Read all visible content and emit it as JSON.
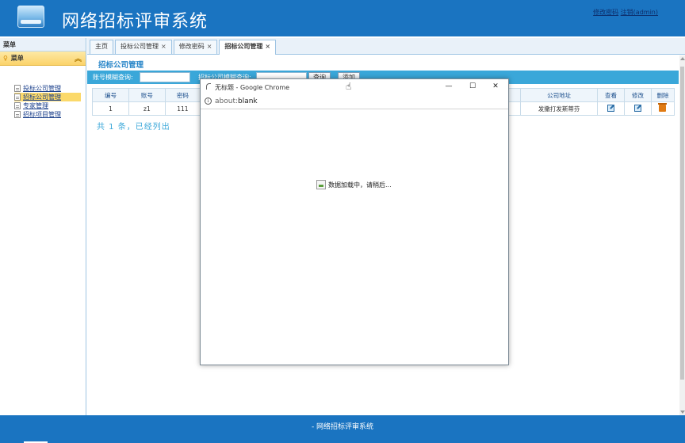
{
  "header": {
    "title": "网络招标评审系统",
    "links": [
      "修改密码",
      "注销(admin)"
    ]
  },
  "sidebar": {
    "header": "菜单",
    "panel_title": "菜单",
    "items": [
      {
        "label": "投标公司管理",
        "active": false
      },
      {
        "label": "招标公司管理",
        "active": true
      },
      {
        "label": "专家管理",
        "active": false
      },
      {
        "label": "招标项目管理",
        "active": false
      }
    ]
  },
  "tabs": [
    {
      "label": "主页",
      "closable": false,
      "active": false
    },
    {
      "label": "投标公司管理",
      "closable": true,
      "active": false
    },
    {
      "label": "修改密码",
      "closable": true,
      "active": false
    },
    {
      "label": "招标公司管理",
      "closable": true,
      "active": true
    }
  ],
  "content": {
    "page_title": "招标公司管理",
    "search": {
      "account_label": "账号模糊查询:",
      "company_label": "招标公司模糊查询:",
      "query_button": "查询",
      "add_button": "添加"
    },
    "table": {
      "headers": [
        "编号",
        "账号",
        "密码",
        "公司地址",
        "查看",
        "修改",
        "删除"
      ],
      "rows": [
        {
          "id": "1",
          "account": "z1",
          "password": "111",
          "address": "发撒打发斯蒂芬"
        }
      ]
    },
    "summary": "共 1 条，已经列出"
  },
  "popup": {
    "window_title": "无标题 - Google Chrome",
    "address_scheme": "about:",
    "address_rest": "blank",
    "loading_text": "数据加载中，请稍后..."
  },
  "footer": {
    "text": "- 网络招标评审系统"
  }
}
